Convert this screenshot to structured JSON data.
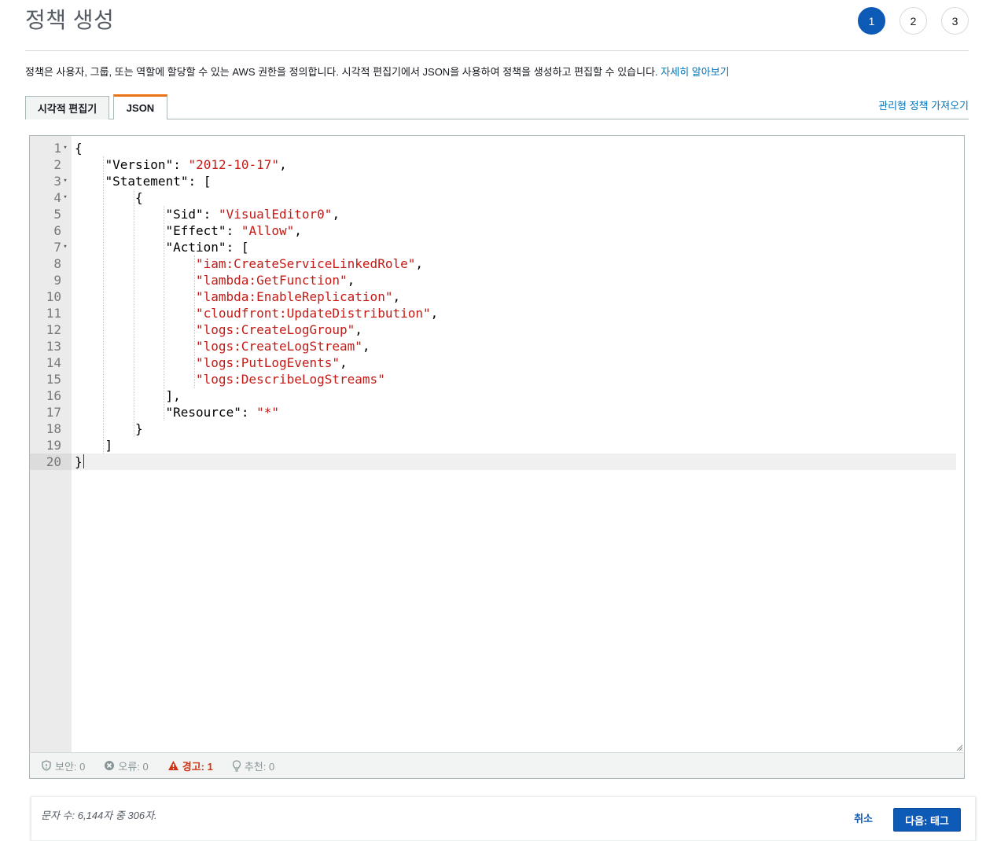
{
  "header": {
    "title": "정책 생성",
    "steps": [
      {
        "label": "1",
        "active": true
      },
      {
        "label": "2",
        "active": false
      },
      {
        "label": "3",
        "active": false
      }
    ]
  },
  "description": {
    "text": "정책은 사용자, 그룹, 또는 역할에 할당할 수 있는 AWS 권한을 정의합니다. 시각적 편집기에서 JSON을 사용하여 정책을 생성하고 편집할 수 있습니다. ",
    "link": "자세히 알아보기"
  },
  "tabs": {
    "visual": "시각적 편집기",
    "json": "JSON",
    "active": "json",
    "import_link": "관리형 정책 가져오기"
  },
  "editor": {
    "active_line": 20,
    "lines": [
      {
        "n": "1",
        "fold": true,
        "indent": 0,
        "parts": [
          [
            "p",
            "{"
          ]
        ]
      },
      {
        "n": "2",
        "fold": false,
        "indent": 1,
        "parts": [
          [
            "p",
            "\"Version\": "
          ],
          [
            "s",
            "\"2012-10-17\""
          ],
          [
            "p",
            ","
          ]
        ]
      },
      {
        "n": "3",
        "fold": true,
        "indent": 1,
        "parts": [
          [
            "p",
            "\"Statement\": ["
          ]
        ]
      },
      {
        "n": "4",
        "fold": true,
        "indent": 2,
        "parts": [
          [
            "p",
            "{"
          ]
        ]
      },
      {
        "n": "5",
        "fold": false,
        "indent": 3,
        "parts": [
          [
            "p",
            "\"Sid\": "
          ],
          [
            "s",
            "\"VisualEditor0\""
          ],
          [
            "p",
            ","
          ]
        ]
      },
      {
        "n": "6",
        "fold": false,
        "indent": 3,
        "parts": [
          [
            "p",
            "\"Effect\": "
          ],
          [
            "s",
            "\"Allow\""
          ],
          [
            "p",
            ","
          ]
        ]
      },
      {
        "n": "7",
        "fold": true,
        "indent": 3,
        "parts": [
          [
            "p",
            "\"Action\": ["
          ]
        ]
      },
      {
        "n": "8",
        "fold": false,
        "indent": 4,
        "parts": [
          [
            "s",
            "\"iam:CreateServiceLinkedRole\""
          ],
          [
            "p",
            ","
          ]
        ]
      },
      {
        "n": "9",
        "fold": false,
        "indent": 4,
        "parts": [
          [
            "s",
            "\"lambda:GetFunction\""
          ],
          [
            "p",
            ","
          ]
        ]
      },
      {
        "n": "10",
        "fold": false,
        "indent": 4,
        "parts": [
          [
            "s",
            "\"lambda:EnableReplication\""
          ],
          [
            "p",
            ","
          ]
        ]
      },
      {
        "n": "11",
        "fold": false,
        "indent": 4,
        "parts": [
          [
            "s",
            "\"cloudfront:UpdateDistribution\""
          ],
          [
            "p",
            ","
          ]
        ]
      },
      {
        "n": "12",
        "fold": false,
        "indent": 4,
        "parts": [
          [
            "s",
            "\"logs:CreateLogGroup\""
          ],
          [
            "p",
            ","
          ]
        ]
      },
      {
        "n": "13",
        "fold": false,
        "indent": 4,
        "parts": [
          [
            "s",
            "\"logs:CreateLogStream\""
          ],
          [
            "p",
            ","
          ]
        ]
      },
      {
        "n": "14",
        "fold": false,
        "indent": 4,
        "parts": [
          [
            "s",
            "\"logs:PutLogEvents\""
          ],
          [
            "p",
            ","
          ]
        ]
      },
      {
        "n": "15",
        "fold": false,
        "indent": 4,
        "parts": [
          [
            "s",
            "\"logs:DescribeLogStreams\""
          ]
        ]
      },
      {
        "n": "16",
        "fold": false,
        "indent": 3,
        "parts": [
          [
            "p",
            "],"
          ]
        ]
      },
      {
        "n": "17",
        "fold": false,
        "indent": 3,
        "parts": [
          [
            "p",
            "\"Resource\": "
          ],
          [
            "s",
            "\"*\""
          ]
        ]
      },
      {
        "n": "18",
        "fold": false,
        "indent": 2,
        "parts": [
          [
            "p",
            "}"
          ]
        ]
      },
      {
        "n": "19",
        "fold": false,
        "indent": 1,
        "parts": [
          [
            "p",
            "]"
          ]
        ]
      },
      {
        "n": "20",
        "fold": false,
        "indent": 0,
        "parts": [
          [
            "p",
            "}"
          ]
        ]
      }
    ]
  },
  "status": {
    "security": "보안: 0",
    "errors": "오류: 0",
    "warnings": "경고: 1",
    "suggestions": "추천: 0"
  },
  "footer": {
    "char_count": "문자 수: 6,144자 중 306자.",
    "cancel": "취소",
    "next": "다음: 태그"
  },
  "colors": {
    "primary": "#0d5ab7",
    "link": "#0073bb",
    "tab_accent": "#ec7211",
    "string": "#c41a16",
    "warning": "#d13212"
  }
}
